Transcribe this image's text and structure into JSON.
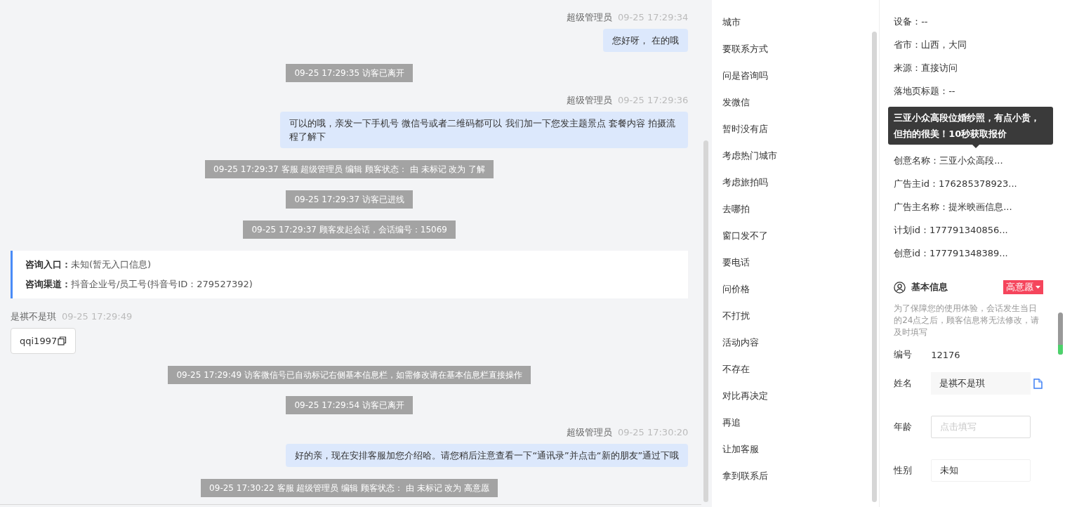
{
  "chat": [
    {
      "kind": "agent",
      "name": "超级管理员",
      "time": "09-25 17:29:34",
      "text": "您好呀， 在的哦"
    },
    {
      "kind": "system",
      "text": "09-25 17:29:35 访客已离开"
    },
    {
      "kind": "agent",
      "name": "超级管理员",
      "time": "09-25 17:29:36",
      "text": "可以的哦，亲发一下手机号 微信号或者二维码都可以 我们加一下您发主题景点 套餐内容 拍摄流程了解下"
    },
    {
      "kind": "system",
      "text": "09-25 17:29:37 客服 超级管理员 编辑 顾客状态： 由 未标记 改为 了解"
    },
    {
      "kind": "system",
      "text": "09-25 17:29:37 访客已进线"
    },
    {
      "kind": "system",
      "text": "09-25 17:29:37 顾客发起会话，会话编号：15069"
    },
    {
      "kind": "entry",
      "rows": [
        {
          "label": "咨询入口：",
          "value": "未知(暂无入口信息)"
        },
        {
          "label": "咨询渠道：",
          "value": "抖音企业号/员工号(抖音号ID：279527392)"
        }
      ]
    },
    {
      "kind": "visitor",
      "name": "是祺不是琪",
      "time": "09-25 17:29:49",
      "text": "qqi1997"
    },
    {
      "kind": "system",
      "text": "09-25 17:29:49 访客微信号已自动标记右侧基本信息栏，如需修改请在基本信息栏直接操作"
    },
    {
      "kind": "system",
      "text": "09-25 17:29:54 访客已离开"
    },
    {
      "kind": "agent",
      "name": "超级管理员",
      "time": "09-25 17:30:20",
      "text": "好的亲，现在安排客服加您介绍哈。请您稍后注意查看一下“通讯录”并点击“新的朋友”通过下哦"
    },
    {
      "kind": "system",
      "text": "09-25 17:30:22 客服 超级管理员 编辑 顾客状态： 由 未标记 改为 高意愿"
    }
  ],
  "quick_replies": [
    "城市",
    "要联系方式",
    "问是咨询吗",
    "发微信",
    "暂时没有店",
    "考虑热门城市",
    "考虑旅拍吗",
    "去哪拍",
    "窗口发不了",
    "要电话",
    "问价格",
    "不打扰",
    "活动内容",
    "不存在",
    "对比再决定",
    "再追",
    "让加客服",
    "拿到联系后"
  ],
  "visitor_info": {
    "rows_top": [
      "设备：--",
      "省市：山西，大同",
      "来源：直接访问",
      "落地页标题：--"
    ],
    "tooltip": "三亚小众高段位婚纱照，有点小贵，但拍的很美！10秒获取报价",
    "rows_bottom": [
      "创意名称：三亚小众高段...",
      "广告主id：176285378923...",
      "广告主名称：提米映画信息...",
      "计划id：177791340856...",
      "创意id：177791348389..."
    ]
  },
  "basic_info": {
    "title": "基本信息",
    "status": "高意愿",
    "note": "为了保障您的使用体验，会话发生当日的24点之后，顾客信息将无法修改，请及时填写",
    "fields": [
      {
        "kind": "text",
        "label": "编号",
        "value": "12176"
      },
      {
        "kind": "copy",
        "label": "姓名",
        "value": "是祺不是琪"
      },
      {
        "kind": "input",
        "label": "年龄",
        "placeholder": "点击填写"
      },
      {
        "kind": "input",
        "label": "性别",
        "value": "未知"
      }
    ]
  }
}
